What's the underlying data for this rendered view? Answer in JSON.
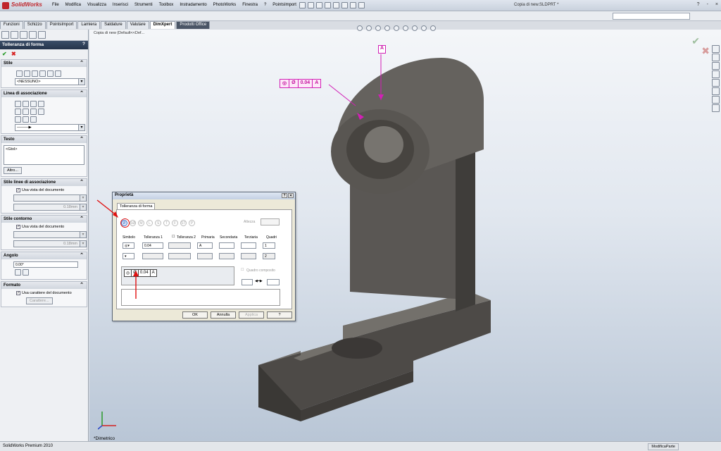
{
  "app": {
    "logo": "SolidWorks",
    "doc_title": "Copia di new.SLDPRT *"
  },
  "menu": [
    "File",
    "Modifica",
    "Visualizza",
    "Inserisci",
    "Strumenti",
    "Toolbox",
    "Instradamento",
    "PhotoWorks",
    "Finestra",
    "?",
    "PointsImport"
  ],
  "window_buttons": [
    "?",
    "-",
    "×"
  ],
  "tabs": [
    "Funzioni",
    "Schizzo",
    "PointsImport",
    "Lamiera",
    "Saldature",
    "Valutare",
    "DimXpert",
    "Prodotti Office"
  ],
  "active_tab": "DimXpert",
  "panel": {
    "title": "Tolleranza di forma",
    "help": "?",
    "sections": {
      "stile": {
        "title": "Stile",
        "combo": "<NESSUNO>"
      },
      "linea": {
        "title": "Linea di associazione"
      },
      "testo": {
        "title": "Testo",
        "text": "<Gtol>",
        "button": "Altro..."
      },
      "stile_linee": {
        "title": "Stile linee di associazione",
        "check": "Usa vista del documento",
        "value": "0.18mm"
      },
      "stile_contorno": {
        "title": "Stile contorno",
        "check": "Usa vista del documento",
        "value": "0.18mm"
      },
      "angolo": {
        "title": "Angolo",
        "value": "0.00°"
      },
      "formato": {
        "title": "Formato",
        "check": "Usa carattere del documento",
        "button": "Carattere..."
      }
    }
  },
  "viewport": {
    "tree_label": "Copia di new  (Default<<Def...",
    "view_name": "*Dimetrico",
    "annotation": {
      "symbol": "◎",
      "diam": "Ø",
      "value": "0.04",
      "datum": "A"
    },
    "datum_flag": "A"
  },
  "dialog": {
    "title": "Proprietà",
    "tab": "Tolleranza di forma",
    "altezza": "Altezza",
    "columns": [
      "Simbolo",
      "Tolleranza 1",
      "Tolleranza 2",
      "Primaria",
      "Secondaria",
      "Terziaria",
      "Quadri"
    ],
    "tol1": "0.04",
    "primary": "A",
    "quadri1": "1",
    "quadri2": "2",
    "composite": "Quadro composito",
    "preview": {
      "symbol": "◎",
      "diam": "Ø",
      "value": "0.04",
      "datum": "A"
    },
    "buttons": [
      "OK",
      "Annulla",
      "Applica",
      "?"
    ]
  },
  "status": {
    "left": "SolidWorks Premium 2010",
    "right": "ModificaParte"
  }
}
